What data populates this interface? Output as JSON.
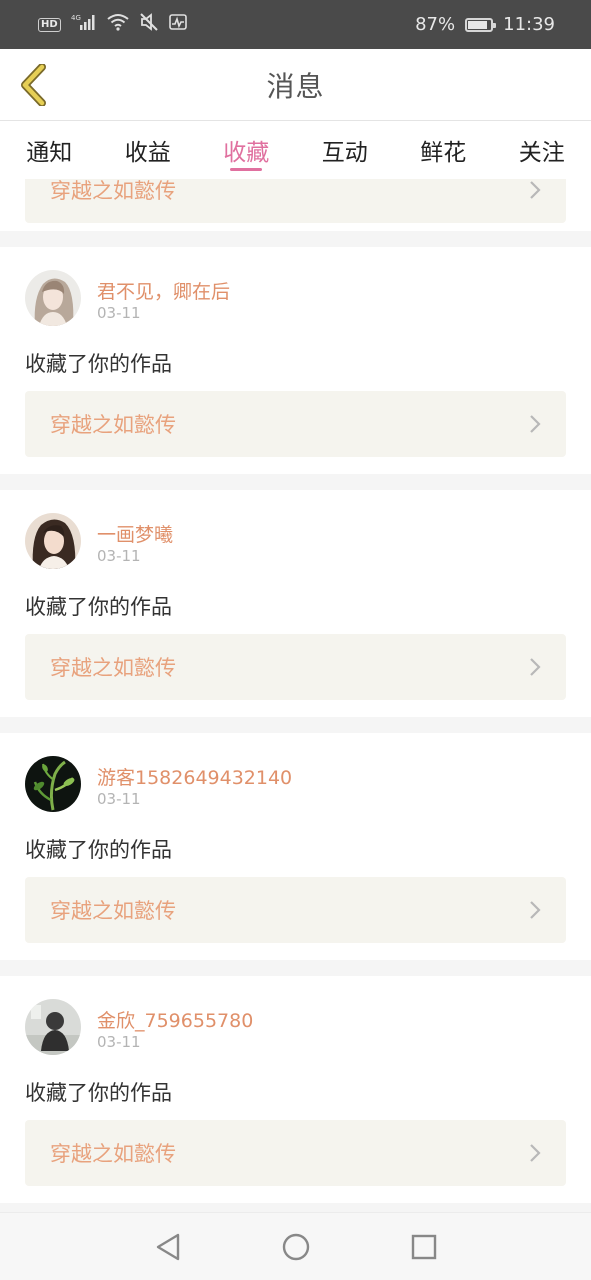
{
  "status_bar": {
    "network_badge": "HD",
    "network_type": "4G",
    "battery": "87%",
    "battery_level": 0.87,
    "time": "11:39",
    "icons": [
      "hd-icon",
      "signal-icon",
      "wifi-icon",
      "mute-icon",
      "activity-icon",
      "battery-icon"
    ]
  },
  "header": {
    "title": "消息",
    "back_icon": "chevron-left-icon",
    "accent": "#c8a82c"
  },
  "tabs": [
    {
      "label": "通知",
      "active": false
    },
    {
      "label": "收益",
      "active": false
    },
    {
      "label": "收藏",
      "active": true
    },
    {
      "label": "互动",
      "active": false
    },
    {
      "label": "鲜花",
      "active": false
    },
    {
      "label": "关注",
      "active": false
    }
  ],
  "colors": {
    "active_tab": "#e0709f",
    "username": "#e0906a",
    "work_title": "#e8a27d",
    "work_box_bg": "#f5f4ee"
  },
  "partial_item": {
    "work_title": "穿越之如懿传"
  },
  "items": [
    {
      "username": "君不见，卿在后",
      "date": "03-11",
      "action": "收藏了你的作品",
      "work_title": "穿越之如懿传",
      "avatar": "avatar-girl-light"
    },
    {
      "username": "一画梦曦",
      "date": "03-11",
      "action": "收藏了你的作品",
      "work_title": "穿越之如懿传",
      "avatar": "avatar-girl-dark-hair"
    },
    {
      "username": "游客1582649432140",
      "date": "03-11",
      "action": "收藏了你的作品",
      "work_title": "穿越之如懿传",
      "avatar": "avatar-plant"
    },
    {
      "username": "金欣_759655780",
      "date": "03-11",
      "action": "收藏了你的作品",
      "work_title": "穿越之如懿传",
      "avatar": "avatar-person-gray"
    }
  ],
  "nav_bar": {
    "icons": [
      "nav-back-icon",
      "nav-home-icon",
      "nav-recent-icon"
    ]
  }
}
